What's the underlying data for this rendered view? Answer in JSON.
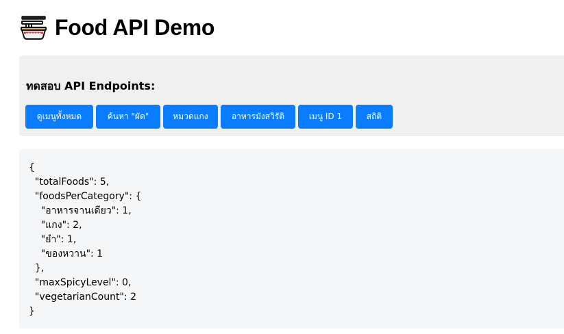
{
  "header": {
    "logo_icon": "noodle-bowl-icon",
    "title": "Food API Demo"
  },
  "controls": {
    "heading": "ทดสอบ API Endpoints:",
    "accent_color": "#0a7cff",
    "buttons": [
      {
        "label": "ดูเมนูทั้งหมด"
      },
      {
        "label": "ค้นหา \"ผัด\""
      },
      {
        "label": "หมวดแกง"
      },
      {
        "label": "อาหารมังสวิรัติ"
      },
      {
        "label": "เมนู ID 1"
      },
      {
        "label": "สถิติ"
      }
    ]
  },
  "result": {
    "text": "{\n  \"totalFoods\": 5,\n  \"foodsPerCategory\": {\n    \"อาหารจานเดียว\": 1,\n    \"แกง\": 2,\n    \"ยำ\": 1,\n    \"ของหวาน\": 1\n  },\n  \"maxSpicyLevel\": 0,\n  \"vegetarianCount\": 2\n}"
  }
}
